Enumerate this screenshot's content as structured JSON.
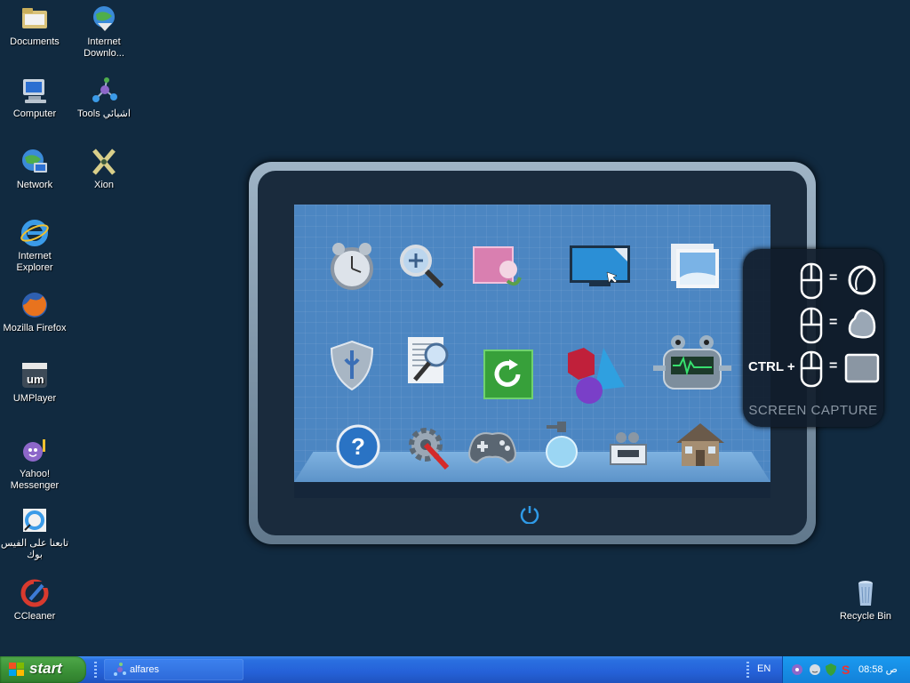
{
  "desktop": {
    "icons": [
      {
        "label": "Documents"
      },
      {
        "label": "Internet Downlo..."
      },
      {
        "label": "Computer"
      },
      {
        "label": "Tools اشيائي"
      },
      {
        "label": "Network"
      },
      {
        "label": "Xion"
      },
      {
        "label": "Internet Explorer"
      },
      {
        "label": "Mozilla Firefox"
      },
      {
        "label": "UMPlayer"
      },
      {
        "label": "Yahoo! Messenger"
      },
      {
        "label": "تابعنا على الفيس بوك"
      },
      {
        "label": "CCleaner"
      },
      {
        "label": "Recycle Bin"
      }
    ]
  },
  "capture_panel": {
    "ctrl_label": "CTRL +",
    "equals": "=",
    "title": "SCREEN CAPTURE"
  },
  "taskbar": {
    "start_label": "start",
    "task_label": "alfares",
    "language": "EN",
    "clock": "08:58 ص"
  },
  "colors": {
    "desktop": "#112a40",
    "tablet_screen": "#4c86c2",
    "taskbar": "#2561d8",
    "start": "#3c9338"
  }
}
